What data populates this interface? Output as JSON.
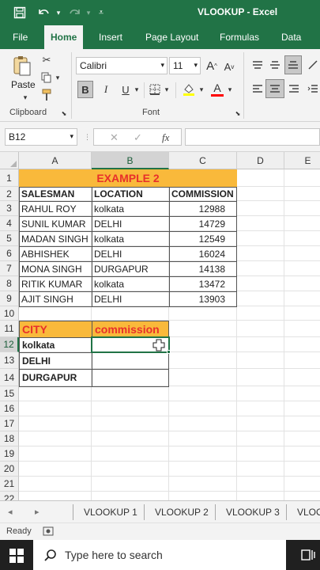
{
  "window": {
    "title": "VLOOKUP - Excel"
  },
  "tabs": [
    "File",
    "Home",
    "Insert",
    "Page Layout",
    "Formulas",
    "Data"
  ],
  "active_tab": "Home",
  "ribbon": {
    "paste_label": "Paste",
    "font_name": "Calibri",
    "font_size": "11",
    "grow_font": "A",
    "shrink_font": "A",
    "bold": "B",
    "underline": "U",
    "font_color_letter": "A",
    "groups": {
      "clipboard": "Clipboard",
      "font": "Font"
    },
    "accent_colors": {
      "highlight": "#ffff00",
      "font": "#ff0000"
    }
  },
  "formula_bar": {
    "name_box": "B12",
    "fx": "fx",
    "value": ""
  },
  "columns": [
    "A",
    "B",
    "C",
    "D",
    "E"
  ],
  "selected_column": "B",
  "rows": [
    "1",
    "2",
    "3",
    "4",
    "5",
    "6",
    "7",
    "8",
    "9",
    "10",
    "11",
    "12",
    "13",
    "14",
    "15",
    "16",
    "17",
    "18",
    "19",
    "20",
    "21",
    "22"
  ],
  "selected_row": "12",
  "sheet": {
    "title": "EXAMPLE 2",
    "headers": [
      "SALESMAN",
      "LOCATION",
      "COMMISSION"
    ],
    "data": [
      [
        "RAHUL ROY",
        "kolkata",
        "12988"
      ],
      [
        "SUNIL KUMAR",
        "DELHI",
        "14729"
      ],
      [
        "MADAN SINGH",
        "kolkata",
        "12549"
      ],
      [
        "ABHISHEK",
        "DELHI",
        "16024"
      ],
      [
        "MONA SINGH",
        "DURGAPUR",
        "14138"
      ],
      [
        "RITIK KUMAR",
        "kolkata",
        "13472"
      ],
      [
        "AJIT SINGH",
        "DELHI",
        "13903"
      ]
    ],
    "lookup_headers": [
      "CITY",
      "commission"
    ],
    "lookup_cities": [
      "kolkata",
      "DELHI",
      "DURGAPUR"
    ],
    "colors": {
      "header_fill": "#f9b93b",
      "title_text": "#e8302a",
      "accent": "#217346"
    }
  },
  "sheet_tabs": [
    "VLOOKUP 1",
    "VLOOKUP 2",
    "VLOOKUP 3",
    "VLOO"
  ],
  "status": {
    "ready": "Ready"
  },
  "taskbar": {
    "search_placeholder": "Type here to search"
  }
}
